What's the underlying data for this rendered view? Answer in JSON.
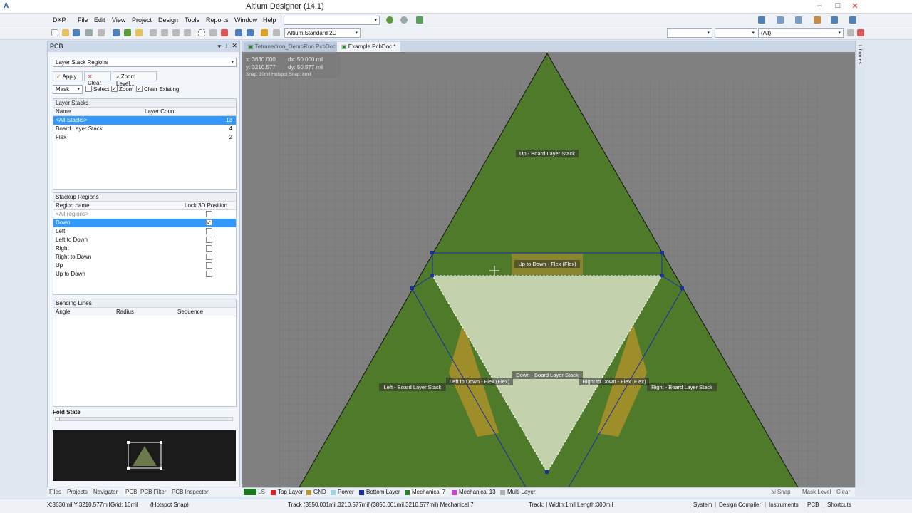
{
  "window": {
    "title": "Altium Designer (14.1)"
  },
  "menu": [
    "DXP",
    "File",
    "Edit",
    "View",
    "Project",
    "Design",
    "Tools",
    "Reports",
    "Window",
    "Help"
  ],
  "toolbar": {
    "view_mode": "Altium Standard 2D",
    "filter_all": "(All)"
  },
  "panel": {
    "title": "PCB",
    "mode": "Layer Stack Regions",
    "apply": "Apply",
    "clear": "Clear",
    "zoom_level": "Zoom Level...",
    "mask": "Mask",
    "select": "Select",
    "zoom": "Zoom",
    "clear_existing": "Clear Existing",
    "layer_stacks": {
      "title": "Layer Stacks",
      "col_name": "Name",
      "col_count": "Layer Count",
      "rows": [
        {
          "name": "<All Stacks>",
          "count": "13"
        },
        {
          "name": "Board Layer Stack",
          "count": "4"
        },
        {
          "name": "Flex",
          "count": "2"
        }
      ]
    },
    "stackup": {
      "title": "Stackup Regions",
      "col_name": "Region name",
      "col_lock": "Lock 3D Position",
      "rows": [
        "<All regions>",
        "Down",
        "Left",
        "Left to Down",
        "Right",
        "Right to Down",
        "Up",
        "Up to Down"
      ]
    },
    "bending": {
      "title": "Bending Lines",
      "col_angle": "Angle",
      "col_radius": "Radius",
      "col_seq": "Sequence"
    },
    "fold_state": "Fold State"
  },
  "doc_tabs": [
    "Tetranedron_DemoRun.PcbDoc",
    "Example.PcbDoc *"
  ],
  "coords": {
    "x": "x: 3630.000",
    "dx": "dx:  50.000 mil",
    "y": "y: 3210.577",
    "dy": "dy:  50.577 mil",
    "snap": "Snap: 10mil Hotspot Snap: 8mil"
  },
  "board_labels": {
    "up": "Up - Board Layer Stack",
    "up_to_down": "Up to Down - Flex (Flex)",
    "down": "Down - Board Layer Stack",
    "left_to_down": "Left to Down - Flex (Flex)",
    "right_to_down": "Right to Down - Flex (Flex)",
    "left": "Left - Board Layer Stack",
    "right": "Right - Board Layer Stack"
  },
  "layers": [
    {
      "name": "LS",
      "color": "#1f7a1f"
    },
    {
      "name": "Top Layer",
      "color": "#e02020"
    },
    {
      "name": "GND",
      "color": "#b8962a"
    },
    {
      "name": "Power",
      "color": "#9fd3e0"
    },
    {
      "name": "Bottom Layer",
      "color": "#1a2ea6"
    },
    {
      "name": "Mechanical 7",
      "color": "#2e7d2e"
    },
    {
      "name": "Mechanical 13",
      "color": "#d040d0"
    },
    {
      "name": "Multi-Layer",
      "color": "#b0b0b0"
    }
  ],
  "layer_bar_right": {
    "snap": "Snap",
    "mask": "Mask Level",
    "clear": "Clear"
  },
  "panel_tabs": [
    "Files",
    "Projects",
    "Navigator",
    "PCB",
    "PCB Filter",
    "PCB Inspector"
  ],
  "status": {
    "pos": "X:3630mil Y:3210.577mil",
    "grid": "Grid: 10mil",
    "snap": "(Hotspot Snap)",
    "track": "Track (3550.001mil,3210.577mil)(3850.001mil,3210.577mil)  Mechanical 7",
    "track_info": "Track: | Width:1mil Length:300mil",
    "buttons": [
      "System",
      "Design Compiler",
      "Instruments",
      "PCB",
      "Shortcuts"
    ]
  },
  "right_strip": "Libraries"
}
